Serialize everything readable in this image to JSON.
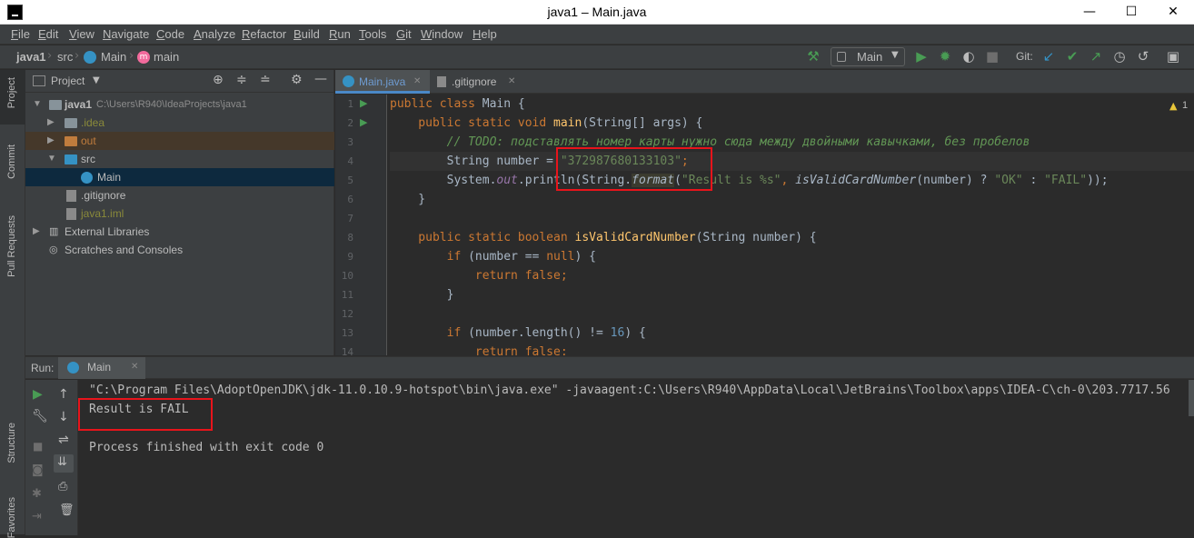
{
  "window": {
    "title": "java1 – Main.java",
    "minimize": "—",
    "maximize": "☐",
    "close": "✕"
  },
  "menu": [
    "File",
    "Edit",
    "View",
    "Navigate",
    "Code",
    "Analyze",
    "Refactor",
    "Build",
    "Run",
    "Tools",
    "Git",
    "Window",
    "Help"
  ],
  "breadcrumb": {
    "project": "java1",
    "folder": "src",
    "class1": "Main",
    "method": "main"
  },
  "toolbar": {
    "run_config": "Main",
    "git_label": "Git:"
  },
  "side_tabs": {
    "project": "Project",
    "commit": "Commit",
    "pull_requests": "Pull Requests",
    "structure": "Structure",
    "favorites": "Favorites"
  },
  "project_panel": {
    "title": "Project",
    "tree": {
      "root_name": "java1",
      "root_path": "C:\\Users\\R940\\IdeaProjects\\java1",
      "idea": ".idea",
      "out": "out",
      "src": "src",
      "main": "Main",
      "gitignore": ".gitignore",
      "iml": "java1.iml",
      "ext_libs": "External Libraries",
      "scratches": "Scratches and Consoles"
    }
  },
  "editor": {
    "tabs": [
      "Main.java",
      ".gitignore"
    ],
    "warning_count": "1",
    "line_numbers": [
      "1",
      "2",
      "3",
      "4",
      "5",
      "6",
      "7",
      "8",
      "9",
      "10",
      "11",
      "12",
      "13",
      "14"
    ],
    "code": {
      "l1_kw": "public class",
      "l1_rest": " Main {",
      "l2_kw": "    public static void ",
      "l2_fn": "main",
      "l2_rest": "(String[] args) {",
      "l3_comment": "        // TODO: подставлять номер карты нужно сюда между двойными кавычками, без пробелов",
      "l4_a": "        String number = ",
      "l4_str": "\"372987680133103\"",
      "l4_semi": ";",
      "l5_a": "        System.",
      "l5_out": "out",
      "l5_b": ".println(String.",
      "l5_format": "format",
      "l5_c": "(",
      "l5_str": "\"Result is %s\"",
      "l5_d": ", ",
      "l5_call": "isValidCardNumber",
      "l5_e": "(number) ? ",
      "l5_ok": "\"OK\"",
      "l5_f": " : ",
      "l5_fail": "\"FAIL\"",
      "l5_g": "));",
      "l6": "    }",
      "l8_kw": "    public static boolean ",
      "l8_fn": "isValidCardNumber",
      "l8_rest": "(String number) {",
      "l9_kw": "        if",
      "l9_a": " (number == ",
      "l9_null": "null",
      "l9_b": ") {",
      "l10_kw": "            return false",
      "l10_b": ";",
      "l11": "        }",
      "l13_kw": "        if",
      "l13_a": " (number.length() != ",
      "l13_num": "16",
      "l13_b": ") {",
      "l14_kw": "            return false",
      "l14_b": ";"
    }
  },
  "run": {
    "label": "Run:",
    "tab": "Main",
    "output": [
      "\"C:\\Program Files\\AdoptOpenJDK\\jdk-11.0.10.9-hotspot\\bin\\java.exe\" -javaagent:C:\\Users\\R940\\AppData\\Local\\JetBrains\\Toolbox\\apps\\IDEA-C\\ch-0\\203.7717.56",
      "Result is FAIL",
      "",
      "Process finished with exit code 0"
    ]
  },
  "colors": {
    "accent_red": "#e8141b",
    "run_green": "#499c54",
    "folder_blue": "#87939a",
    "excluded_orange": "#c07c3d"
  }
}
